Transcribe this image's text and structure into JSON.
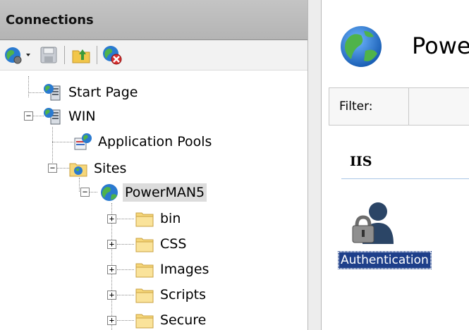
{
  "connections": {
    "title": "Connections",
    "toolbar": [
      {
        "name": "connect-globe-icon"
      },
      {
        "name": "save-icon"
      },
      {
        "name": "up-folder-icon"
      },
      {
        "name": "disconnect-icon"
      }
    ],
    "tree": {
      "start_page": "Start Page",
      "server": "WIN",
      "app_pools": "Application Pools",
      "sites": "Sites",
      "site": "PowerMAN5",
      "folders": [
        "bin",
        "CSS",
        "Images",
        "Scripts",
        "Secure"
      ]
    }
  },
  "main": {
    "title": "Powe",
    "filter_label": "Filter:",
    "section": "IIS",
    "feature": "Authentication"
  },
  "colors": {
    "selection": "#1e3f8a",
    "header_bg": "#bcbcbc",
    "folder": "#f6d77a"
  }
}
